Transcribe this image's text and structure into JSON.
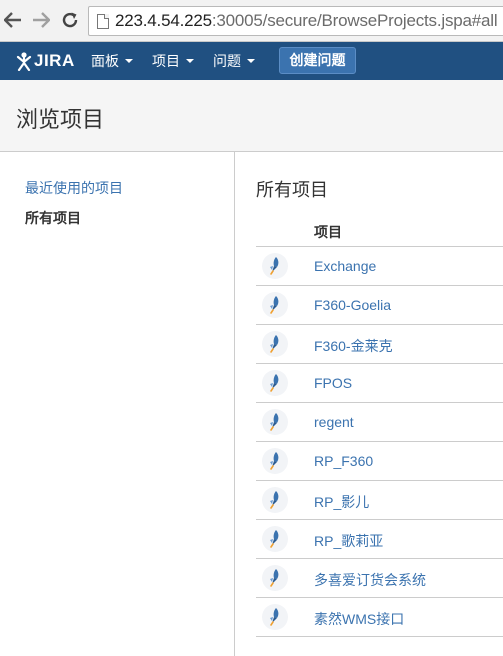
{
  "browser": {
    "back_icon": "arrow-left-icon",
    "forward_icon": "arrow-right-icon",
    "reload_icon": "reload-icon",
    "url_host": "223.4.54.225",
    "url_path": ":30005/secure/BrowseProjects.jspa#all"
  },
  "header": {
    "logo_text": "JIRA",
    "menu": [
      {
        "label": "面板"
      },
      {
        "label": "项目"
      },
      {
        "label": "问题"
      }
    ],
    "create_label": "创建问题",
    "bg_color": "#205081"
  },
  "page": {
    "title": "浏览项目"
  },
  "sidebar": {
    "items": [
      {
        "label": "最近使用的项目",
        "active": false
      },
      {
        "label": "所有项目",
        "active": true
      }
    ]
  },
  "main": {
    "section_title": "所有项目",
    "column_header": "项目",
    "projects": [
      {
        "name": "Exchange"
      },
      {
        "name": "F360-Goelia"
      },
      {
        "name": "F360-金莱克"
      },
      {
        "name": "FPOS"
      },
      {
        "name": "regent"
      },
      {
        "name": "RP_F360"
      },
      {
        "name": "RP_影儿"
      },
      {
        "name": "RP_歌莉亚"
      },
      {
        "name": "多喜爱订货会系统"
      },
      {
        "name": "素然WMS接口"
      }
    ],
    "link_color": "#3b73af"
  }
}
